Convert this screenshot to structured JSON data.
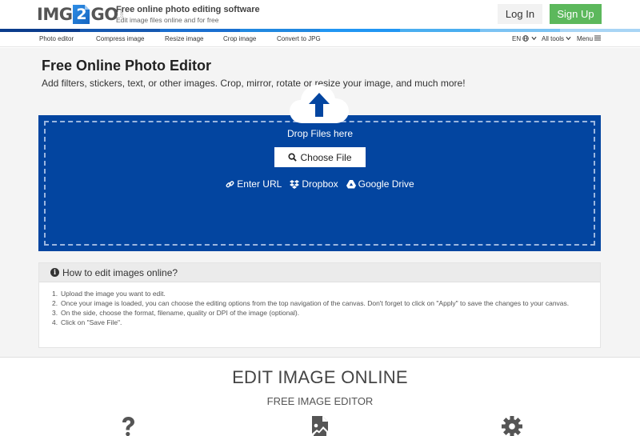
{
  "header": {
    "logo": {
      "left": "IMG",
      "num": "2",
      "right": "GO",
      "suffix": ".com"
    },
    "tagline_title": "Free online photo editing software",
    "tagline_sub": "Edit image files online and for free",
    "login_label": "Log In",
    "signup_label": "Sign Up",
    "brand_colors": [
      "#0b3c8c",
      "#1558b0",
      "#1a6fd0",
      "#2188e0",
      "#2196f3",
      "#4aaef0",
      "#7cc3f3",
      "#a8d5f5"
    ]
  },
  "nav": {
    "items": [
      {
        "label": "Photo editor"
      },
      {
        "label": "Compress image"
      },
      {
        "label": "Resize image"
      },
      {
        "label": "Crop image"
      },
      {
        "label": "Convert to JPG"
      }
    ],
    "language": "EN",
    "all_tools": "All tools",
    "menu": "Menu"
  },
  "main": {
    "title": "Free Online Photo Editor",
    "subtitle": "Add filters, stickers, text, or other images. Crop, mirror, rotate or resize your image, and much more!",
    "dropzone": {
      "drop_text": "Drop Files here",
      "choose_label": "Choose File",
      "sources": [
        {
          "label": "Enter URL",
          "icon": "link-icon"
        },
        {
          "label": "Dropbox",
          "icon": "dropbox-icon"
        },
        {
          "label": "Google Drive",
          "icon": "google-drive-icon"
        }
      ],
      "color": "#0345a0"
    },
    "howto": {
      "title": "How to edit images online?",
      "steps": [
        {
          "n": "1.",
          "text": "Upload the image you want to edit."
        },
        {
          "n": "2.",
          "text": "Once your image is loaded, you can choose the editing options from the top navigation of the canvas. Don't forget to click on \"Apply\" to save the changes to your canvas."
        },
        {
          "n": "3.",
          "text": "On the side, choose the format, filename, quality or DPI of the image (optional)."
        },
        {
          "n": "4.",
          "text": "Click on \"Save File\"."
        }
      ]
    }
  },
  "lower": {
    "title": "EDIT IMAGE ONLINE",
    "subtitle": "FREE IMAGE EDITOR",
    "features": [
      {
        "icon": "question-icon"
      },
      {
        "icon": "image-file-icon"
      },
      {
        "icon": "gear-icon"
      }
    ]
  }
}
